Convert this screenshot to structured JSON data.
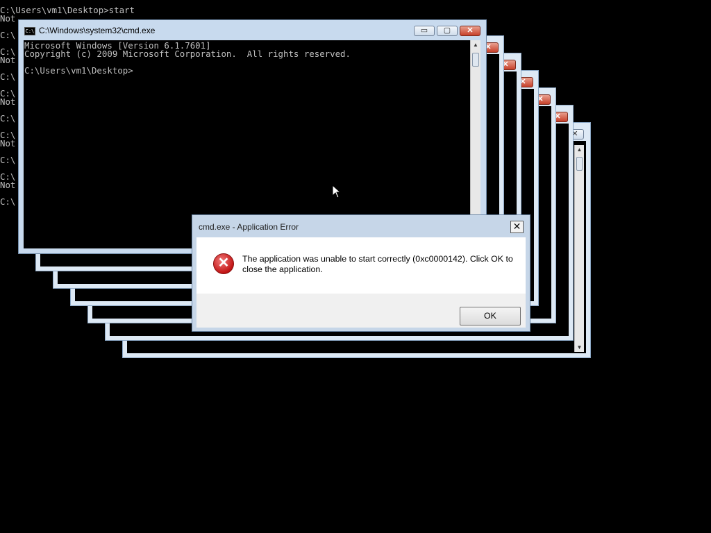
{
  "background_console": {
    "first_line": "C:\\Users\\vm1\\Desktop>start",
    "lines": [
      "Not",
      "C:\\",
      "C:\\",
      "Not",
      "C:\\",
      "C:\\",
      "Not",
      "C:\\",
      "C:\\",
      "Not",
      "C:\\",
      "C:\\",
      "Not",
      "C:\\"
    ]
  },
  "main_window": {
    "title": "C:\\Windows\\system32\\cmd.exe",
    "icon_label": "C:\\",
    "lines": [
      "Microsoft Windows [Version 6.1.7601]",
      "Copyright (c) 2009 Microsoft Corporation.  All rights reserved.",
      "",
      "C:\\Users\\vm1\\Desktop>"
    ]
  },
  "caption_buttons": {
    "minimize": "▭",
    "maximize": "▢",
    "close": "✕"
  },
  "dialog": {
    "title": "cmd.exe - Application Error",
    "close": "✕",
    "message": "The application was unable to start correctly (0xc0000142). Click OK to close the application.",
    "ok_label": "OK",
    "icon_glyph": "✕"
  },
  "colors": {
    "console_text": "#c0c0c0",
    "error_red": "#c21515",
    "frame": "#c8daee"
  }
}
